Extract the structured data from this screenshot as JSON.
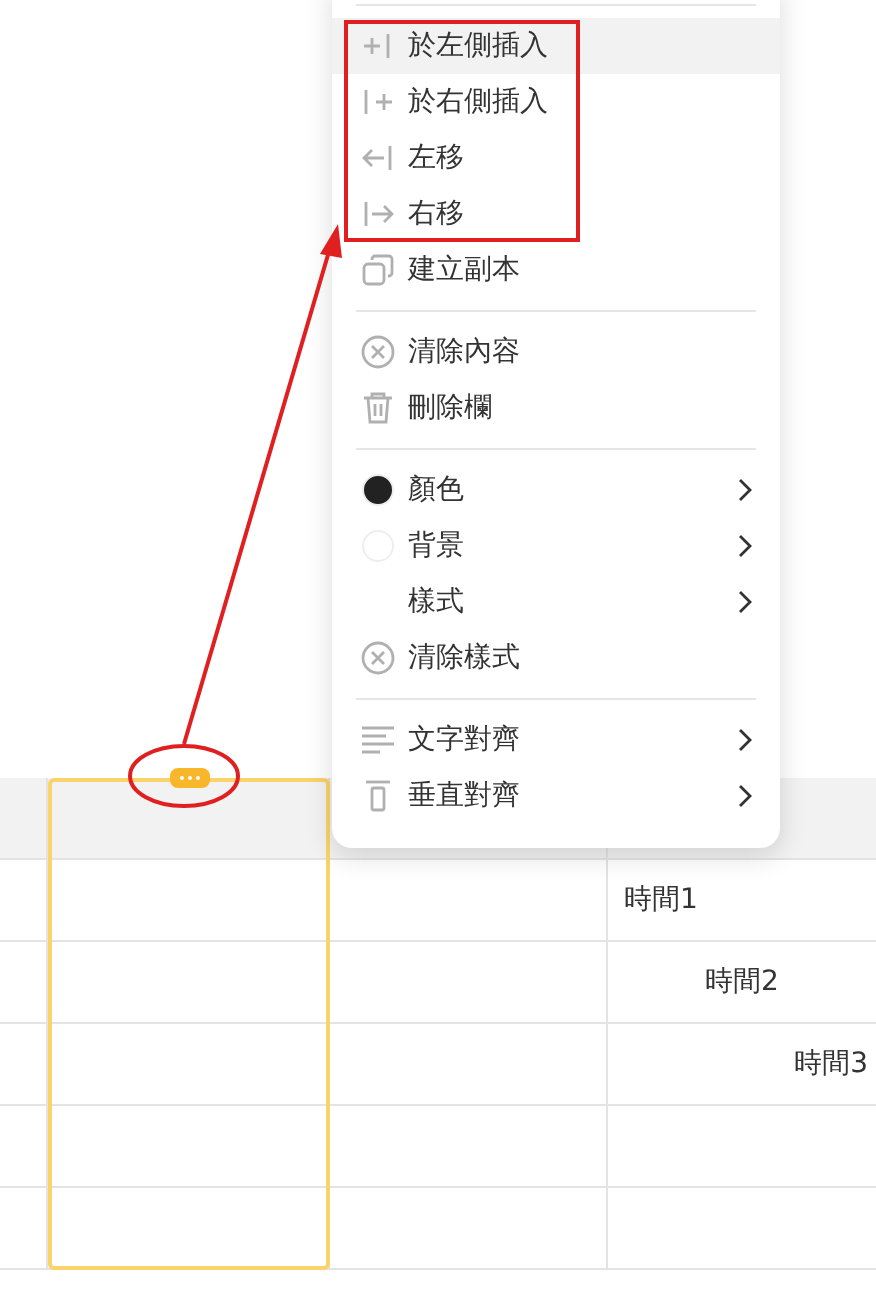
{
  "context_menu": {
    "groups": [
      {
        "items": [
          {
            "label": "於左側插入",
            "kind": "insertleft",
            "submenu": false,
            "selected": true
          },
          {
            "label": "於右側插入",
            "kind": "insertright",
            "submenu": false,
            "selected": false
          },
          {
            "label": "左移",
            "kind": "moveleft",
            "submenu": false,
            "selected": false
          },
          {
            "label": "右移",
            "kind": "moveright",
            "submenu": false,
            "selected": false
          },
          {
            "label": "建立副本",
            "kind": "duplicate",
            "submenu": false,
            "selected": false
          }
        ]
      },
      {
        "items": [
          {
            "label": "清除內容",
            "kind": "clear",
            "submenu": false,
            "selected": false
          },
          {
            "label": "刪除欄",
            "kind": "trash",
            "submenu": false,
            "selected": false
          }
        ]
      },
      {
        "items": [
          {
            "label": "顏色",
            "kind": "swatch",
            "color": "#222222",
            "submenu": true,
            "selected": false
          },
          {
            "label": "背景",
            "kind": "swatch",
            "color": "#ffffff",
            "submenu": true,
            "selected": false
          },
          {
            "label": "樣式",
            "kind": "plain",
            "submenu": true,
            "selected": false
          },
          {
            "label": "清除樣式",
            "kind": "clear",
            "submenu": false,
            "selected": false
          }
        ]
      },
      {
        "items": [
          {
            "label": "文字對齊",
            "kind": "aligntext",
            "submenu": true,
            "selected": false
          },
          {
            "label": "垂直對齊",
            "kind": "alignvertical",
            "submenu": true,
            "selected": false
          }
        ]
      }
    ]
  },
  "table": {
    "columns": [
      {
        "selected": false
      },
      {
        "selected": true
      },
      {
        "selected": false
      },
      {
        "selected": false
      }
    ],
    "rows": [
      {
        "text": "時間1",
        "kind": "left"
      },
      {
        "text": "時間2",
        "kind": "center"
      },
      {
        "text": "時間3",
        "kind": "right"
      }
    ]
  }
}
